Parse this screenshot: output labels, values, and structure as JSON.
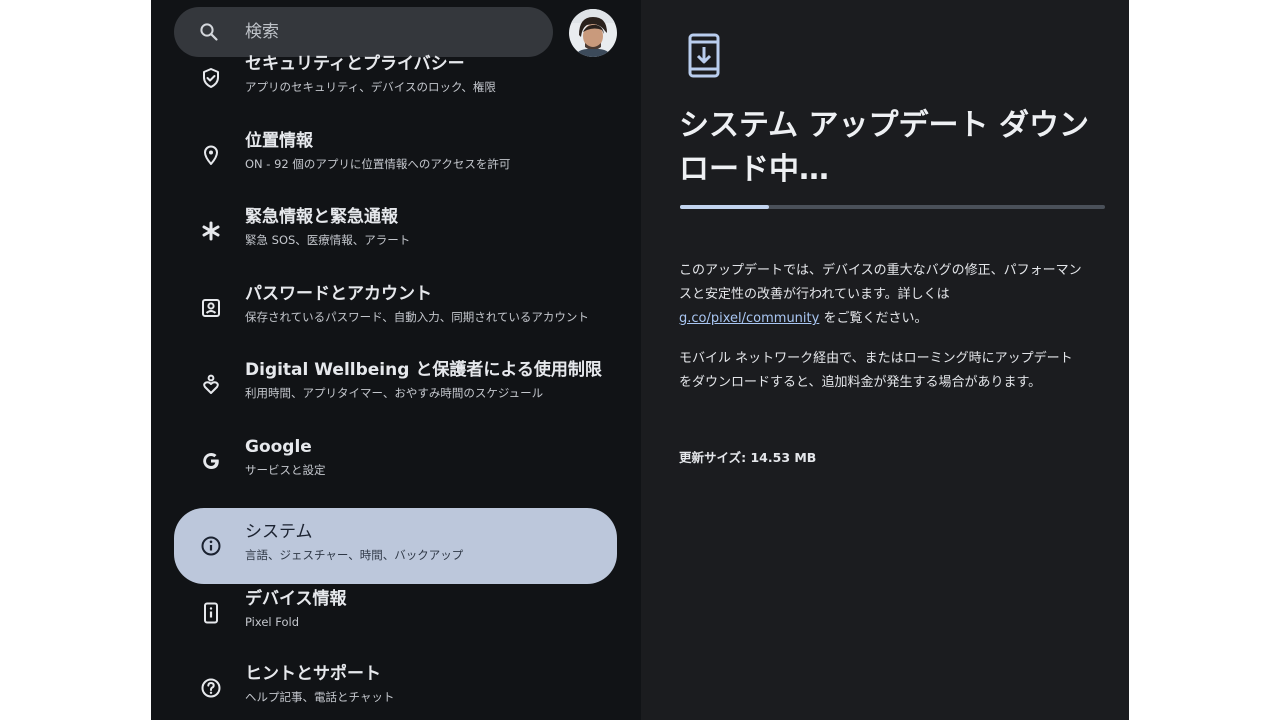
{
  "search": {
    "placeholder": "検索",
    "icon": "search-icon"
  },
  "avatar": {
    "icon": "profile-photo"
  },
  "menu": [
    {
      "title": "セキュリティとプライバシー",
      "subtitle": "アプリのセキュリティ、デバイスのロック、権限",
      "icon": "shield-check-icon"
    },
    {
      "title": "位置情報",
      "subtitle": "ON - 92 個のアプリに位置情報へのアクセスを許可",
      "icon": "location-pin-icon"
    },
    {
      "title": "緊急情報と緊急通報",
      "subtitle": "緊急 SOS、医療情報、アラート",
      "icon": "asterisk-icon"
    },
    {
      "title": "パスワードとアカウント",
      "subtitle": "保存されているパスワード、自動入力、同期されているアカウント",
      "icon": "account-box-icon"
    },
    {
      "title": "Digital Wellbeing と保護者による使用制限",
      "subtitle": "利用時間、アプリタイマー、おやすみ時間のスケジュール",
      "icon": "wellbeing-icon"
    },
    {
      "title": "Google",
      "subtitle": "サービスと設定",
      "icon": "google-icon"
    },
    {
      "title": "システム",
      "subtitle": "言語、ジェスチャー、時間、バックアップ",
      "icon": "info-icon",
      "selected": true
    },
    {
      "title": "デバイス情報",
      "subtitle": "Pixel Fold",
      "icon": "device-info-icon"
    },
    {
      "title": "ヒントとサポート",
      "subtitle": "ヘルプ記事、電話とチャット",
      "icon": "help-icon"
    }
  ],
  "detail": {
    "icon": "system-update-icon",
    "headline": "システム アップデート ダウンロード中…",
    "progress": 0.21,
    "para1_before": "このアップデートでは、デバイスの重大なバグの修正、パフォーマンスと安定性の改善が行われています。詳しくは ",
    "para1_link": "g.co/pixel/community",
    "para1_after": " をご覧ください。",
    "para2": "モバイル ネットワーク経由で、またはローミング時にアップデートをダウンロードすると、追加料金が発生する場合があります。",
    "size_text": "更新サイズ: 14.53 MB"
  },
  "colors": {
    "left_bg": "#111316",
    "right_bg": "#1b1c1f",
    "selected_bg": "#bcc7db",
    "link": "#a9c6f2",
    "progress_fill": "#c2d4ef"
  }
}
